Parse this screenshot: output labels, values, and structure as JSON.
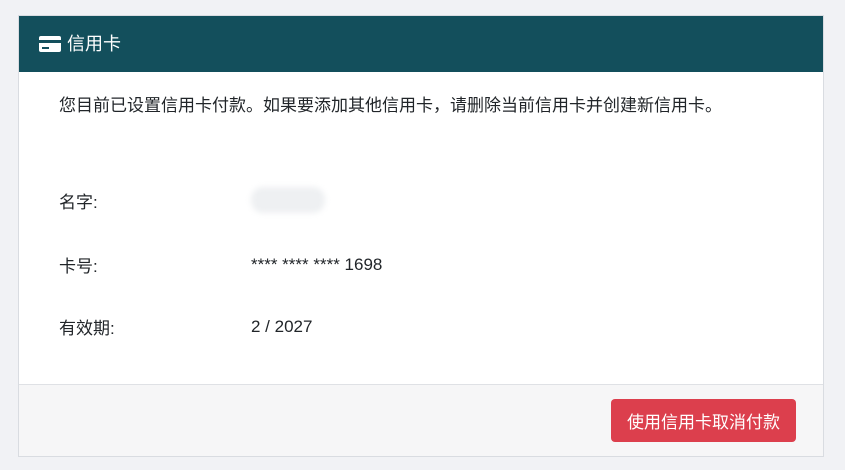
{
  "card": {
    "header": {
      "icon": "credit-card-icon",
      "title": "信用卡"
    },
    "notice": "您目前已设置信用卡付款。如果要添加其他信用卡，请删除当前信用卡并创建新信用卡。",
    "fields": {
      "name_label": "名字:",
      "name_value_redacted": true,
      "card_number_label": "卡号:",
      "card_number_value": "**** **** **** 1698",
      "expiry_label": "有效期:",
      "expiry_value": "2 / 2027"
    },
    "footer": {
      "cancel_button_label": "使用信用卡取消付款"
    }
  },
  "colors": {
    "header_bg": "#134f5c",
    "button_bg": "#dc3f4d",
    "page_bg": "#f1f2f5"
  }
}
